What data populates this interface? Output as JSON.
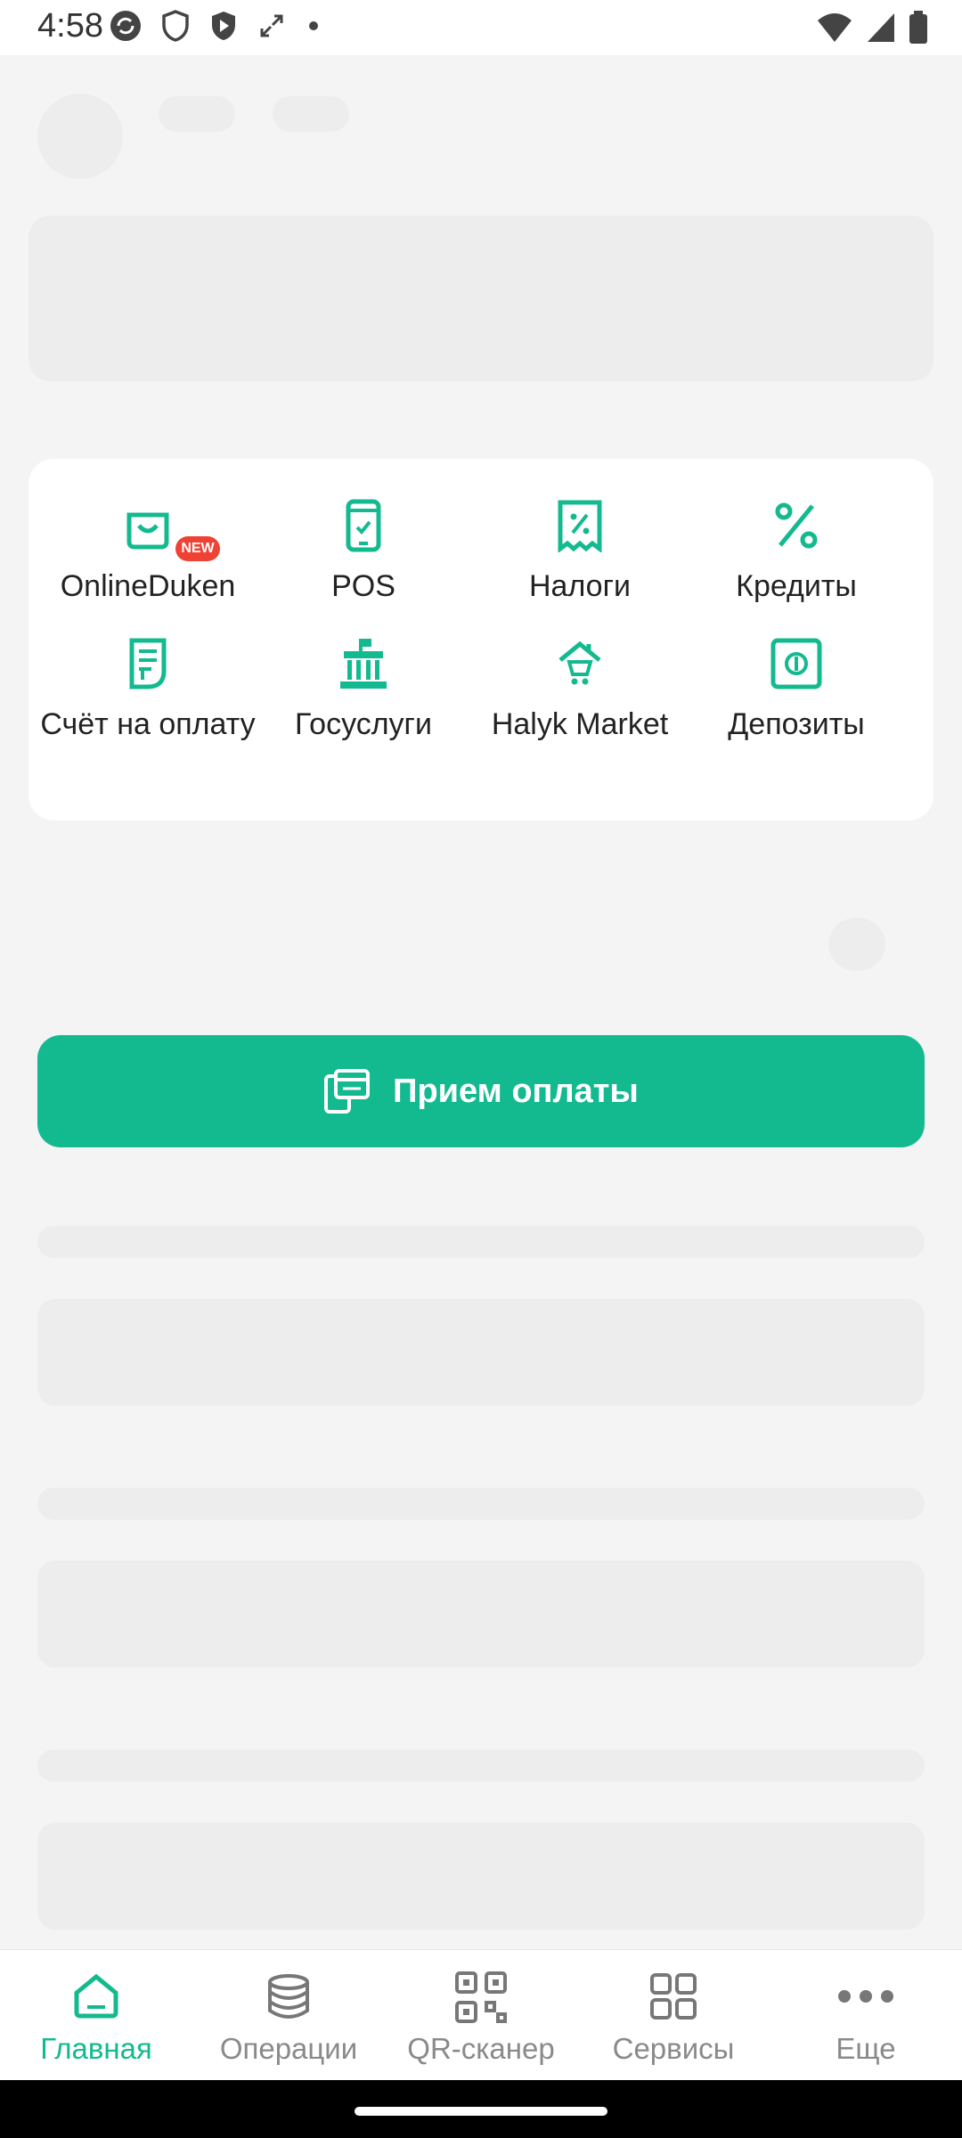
{
  "status_bar": {
    "time": "4:58"
  },
  "services": [
    {
      "label": "OnlineDuken",
      "icon": "shopping-bag-icon",
      "badge": "NEW"
    },
    {
      "label": "POS",
      "icon": "phone-check-icon"
    },
    {
      "label": "Налоги",
      "icon": "tax-receipt-icon"
    },
    {
      "label": "Кредиты",
      "icon": "percent-icon"
    },
    {
      "label": "Счёт на оплату",
      "icon": "invoice-icon"
    },
    {
      "label": "Госуслуги",
      "icon": "government-building-icon"
    },
    {
      "label": "Halyk Market",
      "icon": "market-house-icon"
    },
    {
      "label": "Депозиты",
      "icon": "safe-icon"
    }
  ],
  "accept_payment": {
    "label": "Прием оплаты",
    "icon": "payment-terminal-icon"
  },
  "bottom_nav": [
    {
      "label": "Главная",
      "icon": "home-icon",
      "active": true
    },
    {
      "label": "Операции",
      "icon": "database-icon"
    },
    {
      "label": "QR-сканер",
      "icon": "qr-code-icon"
    },
    {
      "label": "Сервисы",
      "icon": "grid-icon"
    },
    {
      "label": "Еще",
      "icon": "more-dots-icon"
    }
  ],
  "colors": {
    "accent": "#14ba8f",
    "badge": "#f04135",
    "background": "#f4f4f4",
    "skeleton": "#ededed"
  }
}
